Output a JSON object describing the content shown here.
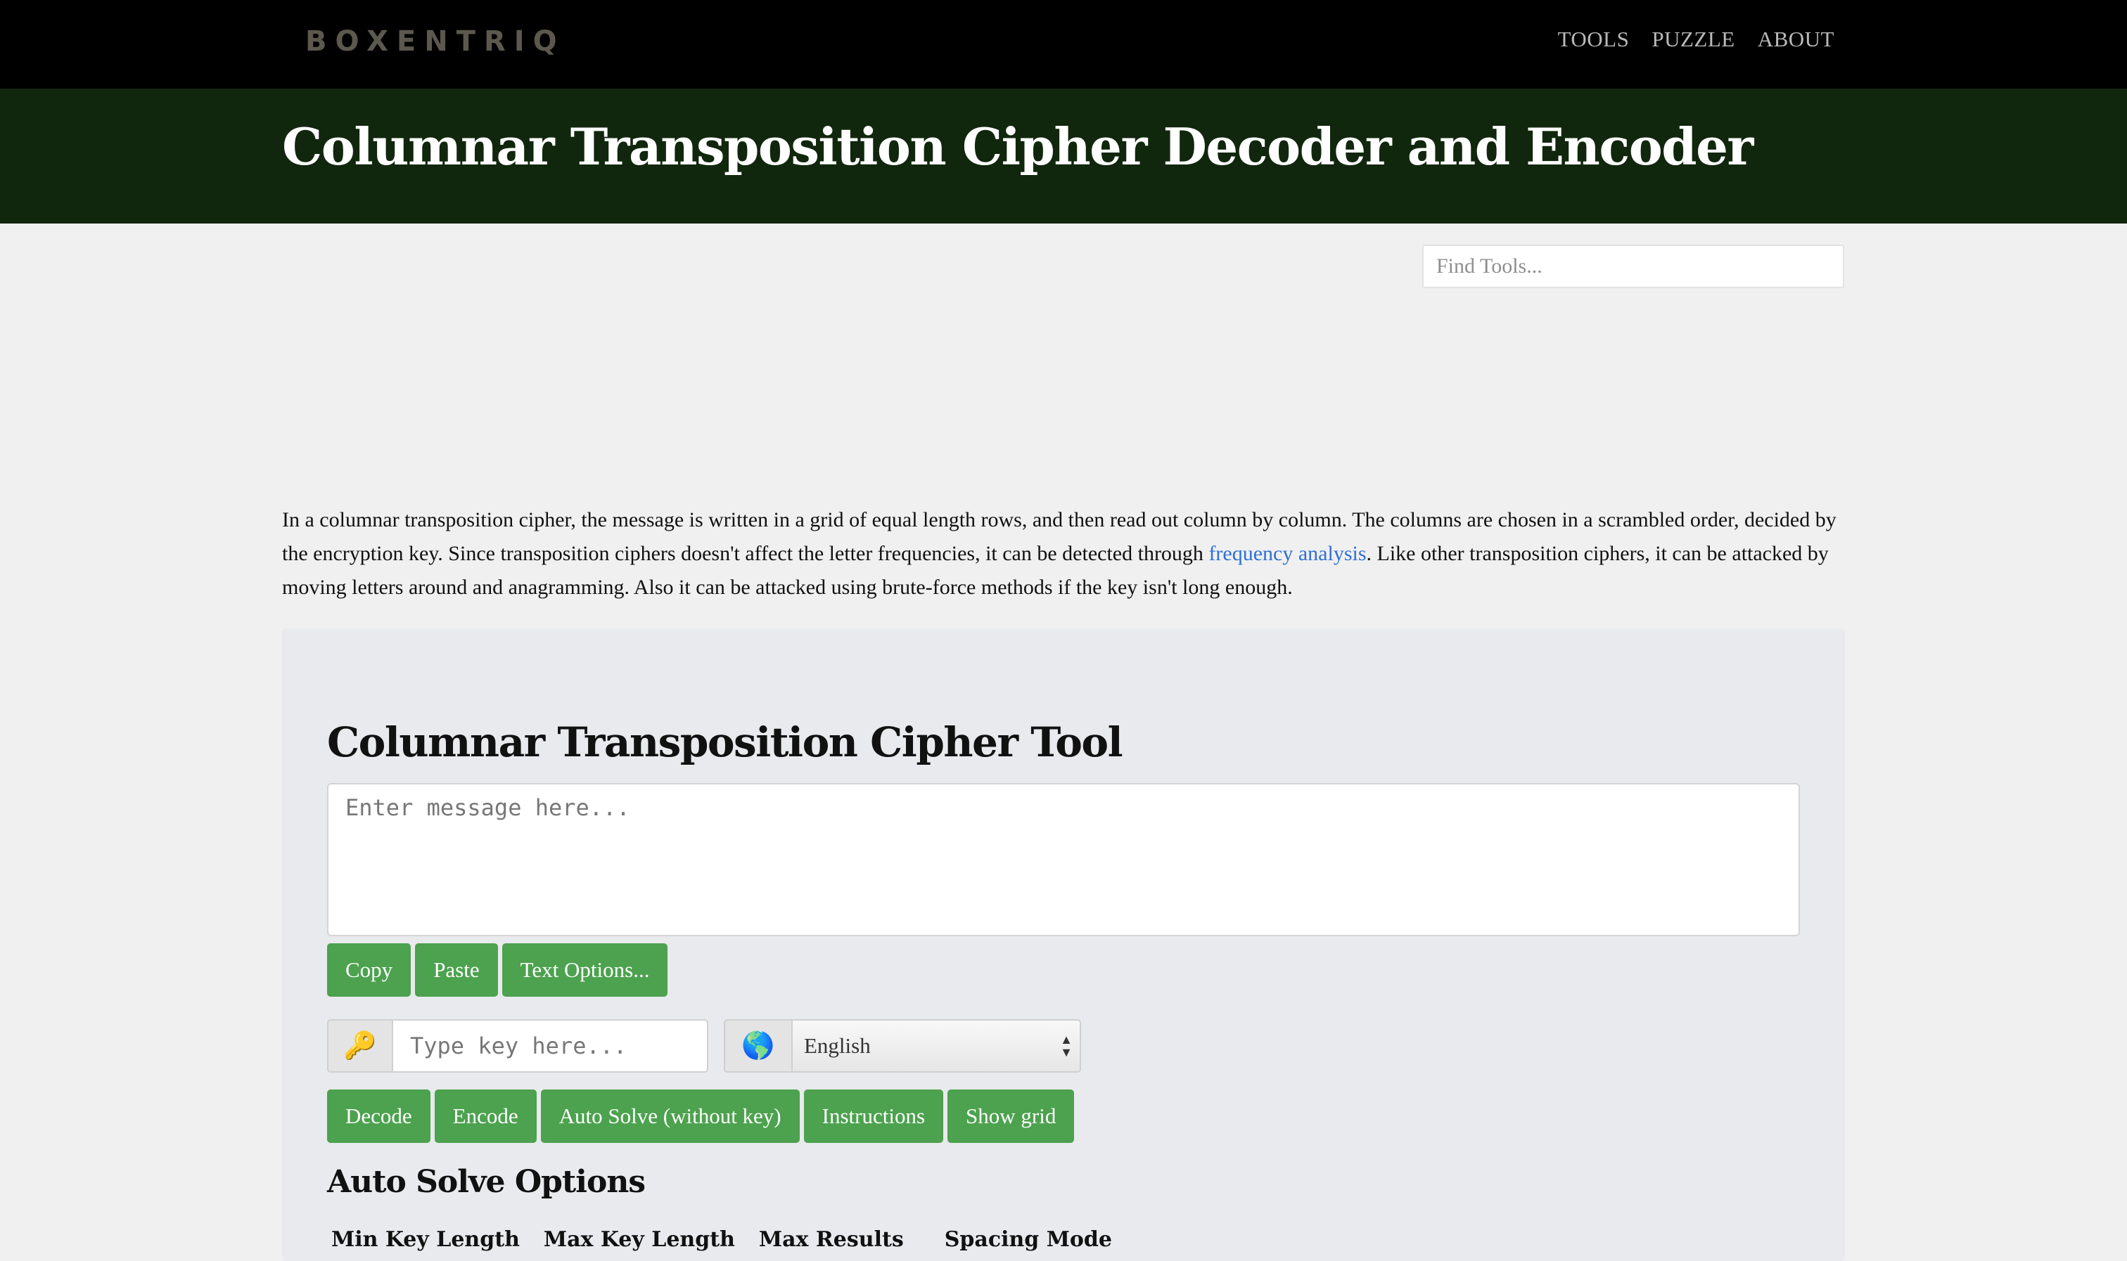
{
  "nav": {
    "logo": "BOXENTRIQ",
    "links": [
      "TOOLS",
      "PUZZLE",
      "ABOUT"
    ]
  },
  "page": {
    "title": "Columnar Transposition Cipher Decoder and Encoder",
    "find_tools_placeholder": "Find Tools..."
  },
  "intro": {
    "text_before_link": "In a columnar transposition cipher, the message is written in a grid of equal length rows, and then read out column by column. The columns are chosen in a scrambled order, decided by the encryption key. Since transposition ciphers doesn't affect the letter frequencies, it can be detected through ",
    "link_text": "frequency analysis",
    "text_after_link": ". Like other transposition ciphers, it can be attacked by moving letters around and anagramming. Also it can be attacked using brute-force methods if the key isn't long enough."
  },
  "tool": {
    "heading": "Columnar Transposition Cipher Tool",
    "message_placeholder": "Enter message here...",
    "text_buttons": [
      "Copy",
      "Paste",
      "Text Options..."
    ],
    "key_icon": "🔑",
    "key_placeholder": "Type key here...",
    "language_icon": "🌎",
    "language_selected": "English",
    "action_buttons": [
      "Decode",
      "Encode",
      "Auto Solve (without key)",
      "Instructions",
      "Show grid"
    ],
    "auto_solve_heading": "Auto Solve Options",
    "option_labels": [
      "Min Key Length",
      "Max Key Length",
      "Max Results",
      "Spacing Mode"
    ]
  },
  "colors": {
    "topbar": "#000000",
    "title_band": "#11270d",
    "button_green": "#4ca24e",
    "link_blue": "#2f6fd6",
    "panel_bg": "#e9eaed",
    "page_bg": "#f0f0f0"
  }
}
